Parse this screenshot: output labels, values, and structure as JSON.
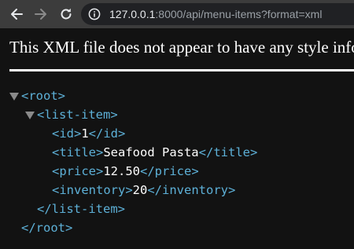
{
  "browser": {
    "url_host": "127.0.0.1",
    "url_rest": ":8000/api/menu-items?format=xml"
  },
  "page": {
    "notice": "This XML file does not appear to have any style information associated with it. The document tree is shown below."
  },
  "xml": {
    "root_open": "<root>",
    "root_close": "</root>",
    "list_item_open": "<list-item>",
    "list_item_close": "</list-item>",
    "id_open": "<id>",
    "id_value": "1",
    "id_close": "</id>",
    "title_open": "<title>",
    "title_value": "Seafood Pasta",
    "title_close": "</title>",
    "price_open": "<price>",
    "price_value": "12.50",
    "price_close": "</price>",
    "inventory_open": "<inventory>",
    "inventory_value": "20",
    "inventory_close": "</inventory>"
  },
  "colors": {
    "tag": "#5db0d7",
    "text": "#ffffff",
    "background": "#121212"
  }
}
